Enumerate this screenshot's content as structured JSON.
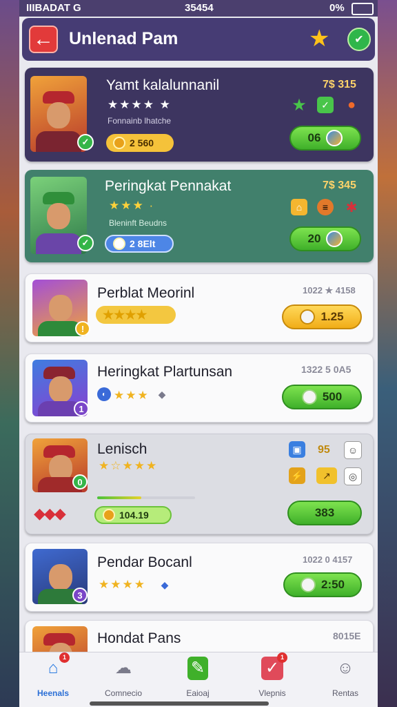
{
  "status_bar": {
    "left": "IIIBADAT G",
    "time": "35454",
    "battery": "0%"
  },
  "header": {
    "title": "Unlenad Pam"
  },
  "cards": [
    {
      "title": "Yamt kalalunnanil",
      "stars": "★★★★ ★",
      "subtext": "Fonnainb lhatche",
      "pill": "2 560",
      "amount": "7$ 315",
      "button": "06"
    },
    {
      "title": "Peringkat Pennakat",
      "stars": "★★★ ·",
      "subtext": "Bleninft Beudns",
      "pill": "2 8Elt",
      "amount": "7$ 345",
      "button": "20"
    },
    {
      "title": "Perblat Meorinl",
      "stars": "★★★★",
      "amount": "1022 ★ 4158",
      "button": "1.25"
    },
    {
      "title": "Heringkat Plartunsan",
      "stars": "★★★",
      "amount": "1322 5 0A5",
      "button": "500"
    },
    {
      "title": "Lenisch",
      "stars": "★☆★★★",
      "amount": "95",
      "pill": "104.19",
      "button": "383",
      "progress": 0.45
    },
    {
      "title": "Pendar Bocanl",
      "stars": "★★★★",
      "amount": "1022 0 4157",
      "button": "2:50"
    },
    {
      "title": "Hondat Pans",
      "amount": "8015E"
    }
  ],
  "nav": [
    {
      "label": "Heenals",
      "badge": "1"
    },
    {
      "label": "Comnecio"
    },
    {
      "label": "Eaioaj"
    },
    {
      "label": "Vlepnis",
      "badge": "1"
    },
    {
      "label": "Rentas"
    }
  ]
}
